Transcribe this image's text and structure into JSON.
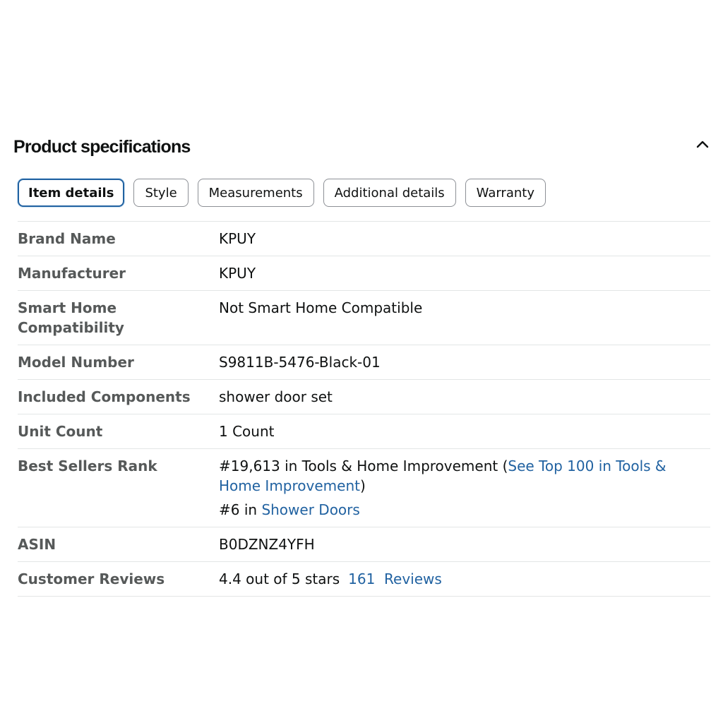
{
  "header": {
    "title": "Product specifications"
  },
  "tabs": [
    {
      "label": "Item details",
      "active": true
    },
    {
      "label": "Style",
      "active": false
    },
    {
      "label": "Measurements",
      "active": false
    },
    {
      "label": "Additional details",
      "active": false
    },
    {
      "label": "Warranty",
      "active": false
    }
  ],
  "details": {
    "brand_name": {
      "label": "Brand Name",
      "value": "KPUY"
    },
    "manufacturer": {
      "label": "Manufacturer",
      "value": "KPUY"
    },
    "smart_home": {
      "label": "Smart Home Compatibility",
      "value": "Not Smart Home Compatible"
    },
    "model_number": {
      "label": "Model Number",
      "value": "S9811B-5476-Black-01"
    },
    "included_components": {
      "label": "Included Components",
      "value": "shower door set"
    },
    "unit_count": {
      "label": "Unit Count",
      "value": "1 Count"
    },
    "best_sellers_rank": {
      "label": "Best Sellers Rank",
      "rank1_text": "#19,613 in Tools & Home Improvement (",
      "rank1_link": "See Top 100 in Tools & Home Improvement",
      "rank1_suffix": ")",
      "rank2_text": "#6 in ",
      "rank2_link": "Shower Doors"
    },
    "asin": {
      "label": "ASIN",
      "value": "B0DZNZ4YFH"
    },
    "customer_reviews": {
      "label": "Customer Reviews",
      "rating_text": "4.4 out of 5 stars",
      "reviews_link": "161  Reviews"
    }
  },
  "colors": {
    "link": "#2162a1",
    "label": "#565959",
    "text": "#0f1111",
    "active_border": "#2162a1",
    "divider": "#e3e6e6"
  },
  "icons": {
    "collapse": "chevron-up-icon"
  }
}
